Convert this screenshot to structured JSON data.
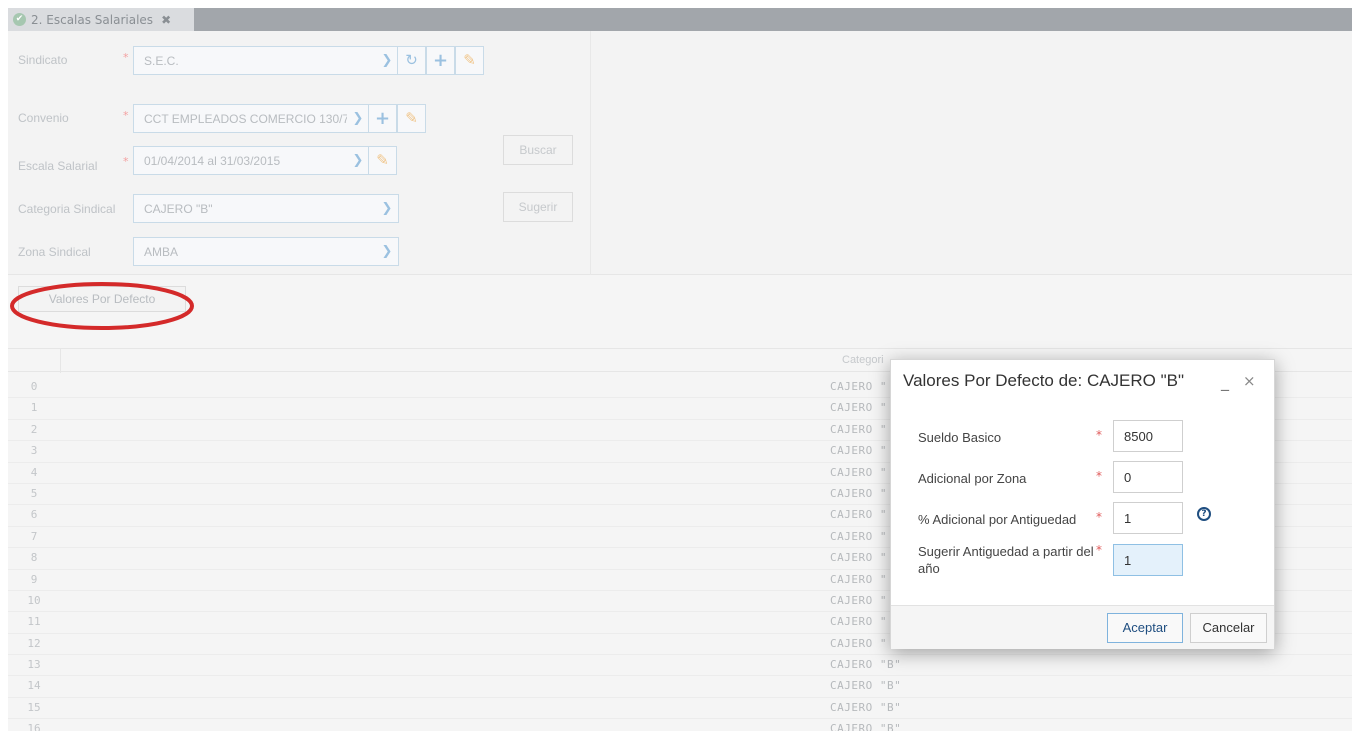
{
  "tab": {
    "label": "2. Escalas Salariales",
    "close": "✖"
  },
  "form": {
    "sindicato": {
      "label": "Sindicato",
      "value": "S.E.C."
    },
    "convenio": {
      "label": "Convenio",
      "value": "CCT EMPLEADOS COMERCIO 130/7"
    },
    "escala": {
      "label": "Escala Salarial",
      "value": "01/04/2014 al 31/03/2015"
    },
    "categoria": {
      "label": "Categoria Sindical",
      "value": "CAJERO \"B\""
    },
    "zona": {
      "label": "Zona Sindical",
      "value": "AMBA"
    },
    "required_mark": "*",
    "buscar_label": "Buscar",
    "sugerir_label": "Sugerir"
  },
  "toolbar": {
    "valores_label": "Valores Por Defecto"
  },
  "grid": {
    "header_categoria": "Categori",
    "rows": [
      {
        "index": "0",
        "categoria": "CAJERO \""
      },
      {
        "index": "1",
        "categoria": "CAJERO \""
      },
      {
        "index": "2",
        "categoria": "CAJERO \""
      },
      {
        "index": "3",
        "categoria": "CAJERO \""
      },
      {
        "index": "4",
        "categoria": "CAJERO \""
      },
      {
        "index": "5",
        "categoria": "CAJERO \""
      },
      {
        "index": "6",
        "categoria": "CAJERO \""
      },
      {
        "index": "7",
        "categoria": "CAJERO \""
      },
      {
        "index": "8",
        "categoria": "CAJERO \""
      },
      {
        "index": "9",
        "categoria": "CAJERO \""
      },
      {
        "index": "10",
        "categoria": "CAJERO \""
      },
      {
        "index": "11",
        "categoria": "CAJERO \""
      },
      {
        "index": "12",
        "categoria": "CAJERO \""
      },
      {
        "index": "13",
        "categoria": "CAJERO \"B\""
      },
      {
        "index": "14",
        "categoria": "CAJERO \"B\""
      },
      {
        "index": "15",
        "categoria": "CAJERO \"B\""
      },
      {
        "index": "16",
        "categoria": "CAJERO \"B\""
      }
    ]
  },
  "modal": {
    "title": "Valores Por Defecto de: CAJERO \"B\"",
    "minimize": "_",
    "close": "×",
    "required_mark": "*",
    "fields": {
      "sueldo": {
        "label": "Sueldo Basico",
        "value": "8500"
      },
      "zona": {
        "label": "Adicional por Zona",
        "value": "0"
      },
      "antiguedad": {
        "label": "% Adicional por Antiguedad",
        "value": "1"
      },
      "sugerir": {
        "label": "Sugerir Antiguedad a partir del año",
        "value": "1"
      }
    },
    "help": "?",
    "aceptar_label": "Aceptar",
    "cancelar_label": "Cancelar"
  },
  "colors": {
    "accent": "#1f4e80",
    "highlight_oval": "#d42a2a",
    "tabbar": "#a2a6ab",
    "focused_input": "#e4f1fb"
  }
}
